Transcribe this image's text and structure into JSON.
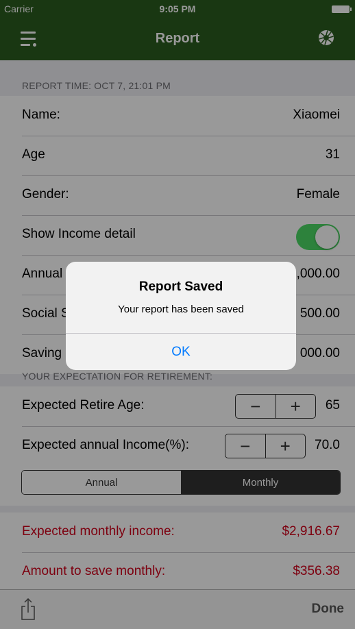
{
  "status_bar": {
    "carrier": "Carrier",
    "time": "9:05 PM"
  },
  "nav": {
    "title": "Report"
  },
  "report": {
    "time_header": "REPORT TIME:  OCT 7, 21:01 PM",
    "name_label": "Name:",
    "name_value": "Xiaomei",
    "age_label": "Age",
    "age_value": "31",
    "gender_label": "Gender:",
    "gender_value": "Female",
    "income_detail_label": "Show Income detail",
    "income_detail_on": true,
    "annual_income_label": "Annual Income",
    "annual_income_value": "$50,000.00",
    "social_label": "Social S",
    "social_value": "500.00",
    "saving_label": "Saving",
    "saving_value": "000.00"
  },
  "expectation": {
    "header": "YOUR EXPECTATION FOR RETIREMENT:",
    "retire_age_label": "Expected Retire Age:",
    "retire_age_value": "65",
    "annual_income_label": "Expected annual Income(%):",
    "annual_income_value": "70.0",
    "stepper_minus": "−",
    "stepper_plus": "+",
    "segments": [
      "Annual",
      "Monthly"
    ],
    "selected_segment": "Monthly"
  },
  "results": {
    "monthly_income_label": "Expected monthly income:",
    "monthly_income_value": "$2,916.67",
    "save_monthly_label": "Amount to save monthly:",
    "save_monthly_value": "$356.38"
  },
  "toolbar": {
    "done_label": "Done"
  },
  "alert": {
    "title": "Report Saved",
    "message": "Your report has been saved",
    "ok_label": "OK"
  },
  "colors": {
    "nav": "#2a5c1f",
    "toggle_on": "#4cd964",
    "result_red": "#d0021b",
    "alert_button": "#007aff"
  }
}
